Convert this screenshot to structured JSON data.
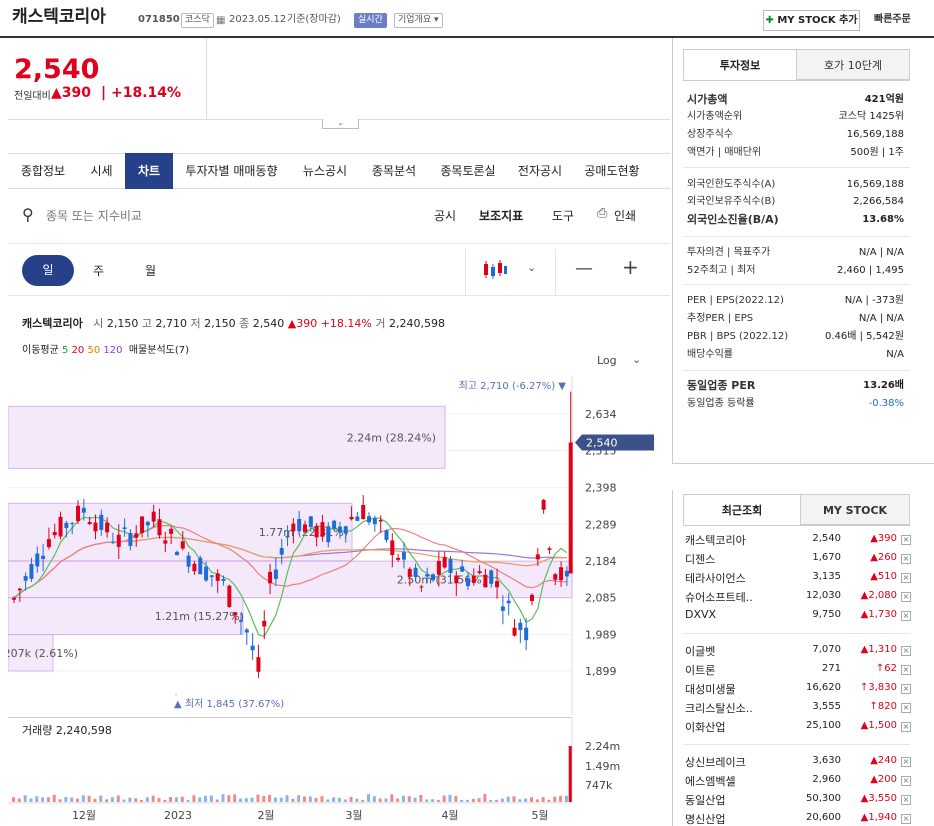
{
  "header": {
    "stock_name": "캐스텍코리아",
    "code": "071850",
    "market": "코스닥",
    "date": "2023.05.12",
    "basis": "기준(장마감)",
    "realtime": "실시간",
    "company_btn": "기업개요",
    "mystock": "MY STOCK 추가",
    "quick": "빠른주문"
  },
  "price": {
    "current": "2,540",
    "label": "전일대비",
    "change": "390",
    "rate": "+18.14%"
  },
  "tabs": [
    "종합정보",
    "시세",
    "차트",
    "투자자별 매매동향",
    "뉴스공시",
    "종목분석",
    "종목토론실",
    "전자공시",
    "공매도현황"
  ],
  "search": {
    "placeholder": "종목 또는 지수비교",
    "links": [
      "공시",
      "보조지표",
      "도구",
      "인쇄"
    ]
  },
  "period": {
    "day": "일",
    "week": "주",
    "month": "월"
  },
  "chart_info": {
    "name": "캐스텍코리아",
    "open_l": "시",
    "open": "2,150",
    "high_l": "고",
    "high": "2,710",
    "low_l": "저",
    "low": "2,150",
    "close_l": "종",
    "close": "2,540",
    "change": "▲390",
    "rate": "+18.14%",
    "vol_l": "거",
    "vol": "2,240,598"
  },
  "ma": {
    "label": "이동평균",
    "v5": "5",
    "v20": "20",
    "v50": "50",
    "v120": "120",
    "extra": "매물분석도(7)"
  },
  "log_label": "Log",
  "annot": {
    "high": "최고 2,710 (-6.27%) ▼",
    "low": "▲ 최저 1,845 (37.67%)",
    "current": "2,540"
  },
  "volume_label": "거래량",
  "volume_value": "2,240,598",
  "colors": {
    "red": "#e0001b",
    "blue": "#1f6bd8",
    "navy": "#26408a",
    "purple": "#c9a0e6"
  },
  "chart_data": [
    {
      "type": "candlestick",
      "y_ticks": [
        2634,
        2515,
        2398,
        2289,
        2184,
        2085,
        1989,
        1899
      ],
      "y_tick_labels": [
        "2,634",
        "2,515",
        "2,398",
        "2,289",
        "2,184",
        "2,085",
        "1,989",
        "1,899"
      ],
      "x_labels": [
        "12월",
        "2023",
        "2월",
        "3월",
        "4월",
        "5월"
      ],
      "scale": "log",
      "high": 2710,
      "low": 1845,
      "last": 2540,
      "volume_profile": [
        {
          "label": "2.24m (28.24%)",
          "lo": 2458,
          "hi": 2660
        },
        {
          "label": "1.77m (22.31%)",
          "lo": 2185,
          "hi": 2351
        },
        {
          "label": "2.50m (31.56%)",
          "lo": 2085,
          "hi": 2184
        },
        {
          "label": "1.21m (15.27%)",
          "lo": 1989,
          "hi": 2085
        },
        {
          "label": "207k (2.61%)",
          "lo": 1899,
          "hi": 1989
        }
      ]
    },
    {
      "type": "bar",
      "title": "거래량",
      "y_ticks": [
        "2.24m",
        "1.49m",
        "747k"
      ]
    }
  ],
  "invest": {
    "tab1": "투자정보",
    "tab2": "호가 10단계",
    "rows": [
      {
        "k": "시가총액",
        "v": "421억원",
        "bold": true
      },
      {
        "k": "시가총액순위",
        "v": "코스닥 1425위"
      },
      {
        "k": "상장주식수",
        "v": "16,569,188"
      },
      {
        "k": "액면가 | 매매단위",
        "v": "500원 | 1주"
      },
      {
        "k": "외국인한도주식수(A)",
        "v": "16,569,188"
      },
      {
        "k": "외국인보유주식수(B)",
        "v": "2,266,584"
      },
      {
        "k": "외국인소진율(B/A)",
        "v": "13.68%",
        "bold": true
      },
      {
        "k": "투자의견 | 목표주가",
        "v": "N/A | N/A"
      },
      {
        "k": "52주최고 | 최저",
        "v": "2,460 | 1,495"
      },
      {
        "k": "PER | EPS(2022.12)",
        "v": "N/A | -373원"
      },
      {
        "k": "추정PER | EPS",
        "v": "N/A | N/A"
      },
      {
        "k": "PBR | BPS (2022.12)",
        "v": "0.46배 | 5,542원"
      },
      {
        "k": "배당수익률",
        "v": "N/A"
      },
      {
        "k": "동일업종 PER",
        "v": "13.26배",
        "bold": true
      },
      {
        "k": "동일업종 등락률",
        "v": "-0.38%",
        "blue": true
      }
    ]
  },
  "recent": {
    "tab1": "최근조회",
    "tab2": "MY STOCK",
    "items": [
      {
        "n": "캐스텍코리아",
        "p": "2,540",
        "c": "▲390"
      },
      {
        "n": "디젠스",
        "p": "1,670",
        "c": "▲260"
      },
      {
        "n": "테라사이언스",
        "p": "3,135",
        "c": "▲510"
      },
      {
        "n": "슈어소프트테..",
        "p": "12,030",
        "c": "▲2,080"
      },
      {
        "n": "DXVX",
        "p": "9,750",
        "c": "▲1,730"
      },
      {
        "n": "이글벳",
        "p": "7,070",
        "c": "▲1,310"
      },
      {
        "n": "이트론",
        "p": "271",
        "c": "↑62"
      },
      {
        "n": "대성미생물",
        "p": "16,620",
        "c": "↑3,830"
      },
      {
        "n": "크리스탈신소..",
        "p": "3,555",
        "c": "↑820"
      },
      {
        "n": "이화산업",
        "p": "25,100",
        "c": "▲1,500"
      },
      {
        "n": "상신브레이크",
        "p": "3,630",
        "c": "▲240"
      },
      {
        "n": "에스엠벡셀",
        "p": "2,960",
        "c": "▲200"
      },
      {
        "n": "동일산업",
        "p": "50,300",
        "c": "▲3,550"
      },
      {
        "n": "명신산업",
        "p": "20,600",
        "c": "▲1,940"
      }
    ]
  }
}
